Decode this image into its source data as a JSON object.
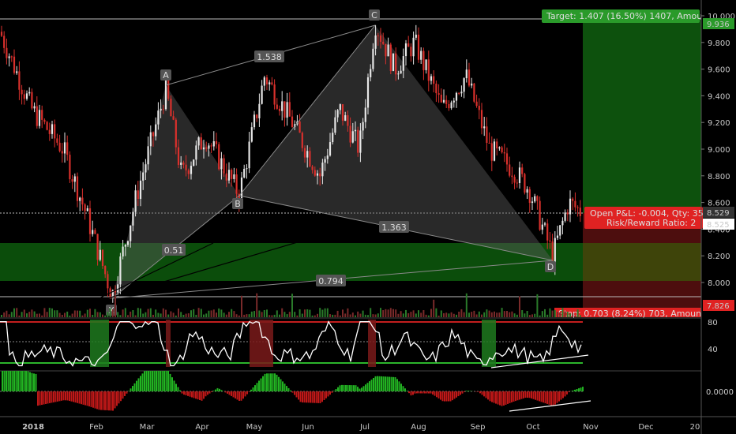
{
  "chart_data": {
    "type": "candlestick",
    "price_axis": {
      "ticks": [
        "10.000",
        "9.800",
        "9.600",
        "9.400",
        "9.200",
        "9.000",
        "8.800",
        "8.600",
        "8.400",
        "8.200",
        "8.000"
      ],
      "ylim": [
        7.8,
        10.1
      ]
    },
    "rsi_axis": {
      "ticks": [
        "80",
        "40"
      ]
    },
    "macd_axis": {
      "ticks": [
        "0.0000"
      ]
    },
    "x_ticks": [
      "2018",
      "Feb",
      "Mar",
      "Apr",
      "May",
      "Jun",
      "Jul",
      "Aug",
      "Sep",
      "Oct",
      "Nov",
      "Dec",
      "20"
    ],
    "pattern_points": [
      {
        "label": "X",
        "price": 7.88
      },
      {
        "label": "A",
        "price": 9.48
      },
      {
        "label": "B",
        "price": 8.66
      },
      {
        "label": "C",
        "price": 9.96
      },
      {
        "label": "D",
        "price": 8.18
      }
    ],
    "ratios": [
      "1.538",
      "0.51",
      "1.363",
      "0.794"
    ],
    "position": {
      "target_text": "Target: 1.407 (16.50%) 1407, Amou",
      "target_price": "9.936",
      "open_pl_text": "Open P&L: -0.004, Qty: 35",
      "risk_reward_text": "Risk/Reward Ratio: 2",
      "entry_price": "8.529",
      "current_price": "8.525",
      "stop_text": "Stop: 0.703 (8.24%) 703, Amoun",
      "stop_price": "7.826",
      "target_level": 9.936,
      "entry_level": 8.529,
      "stop_level": 7.826
    },
    "prz_zone": [
      8.02,
      8.3
    ],
    "colors": {
      "up": "#e6e6e6",
      "down": "#d9302c",
      "target_green": "#2db32d",
      "stop_red": "#e83030",
      "zone": "#0c4a0c"
    }
  }
}
